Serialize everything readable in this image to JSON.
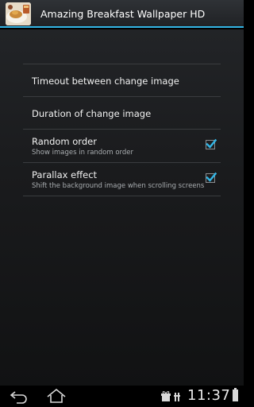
{
  "app": {
    "title": "Amazing Breakfast Wallpaper HD",
    "icon": "breakfast-thumbnail-icon"
  },
  "settings": {
    "items": [
      {
        "title": "Timeout between change image"
      },
      {
        "title": "Duration of change image"
      },
      {
        "title": "Random order",
        "summary": "Show images in random order",
        "checked": true
      },
      {
        "title": "Parallax effect",
        "summary": "Shift the background image when scrolling screens",
        "checked": true
      }
    ]
  },
  "status_bar": {
    "time": "11:37",
    "icons": [
      "gift-icon",
      "usb-debug-icon",
      "battery-icon"
    ]
  },
  "nav": {
    "back": "back-icon",
    "home": "home-icon"
  },
  "colors": {
    "accent": "#33b5e5",
    "background": "#1a1b1d"
  }
}
